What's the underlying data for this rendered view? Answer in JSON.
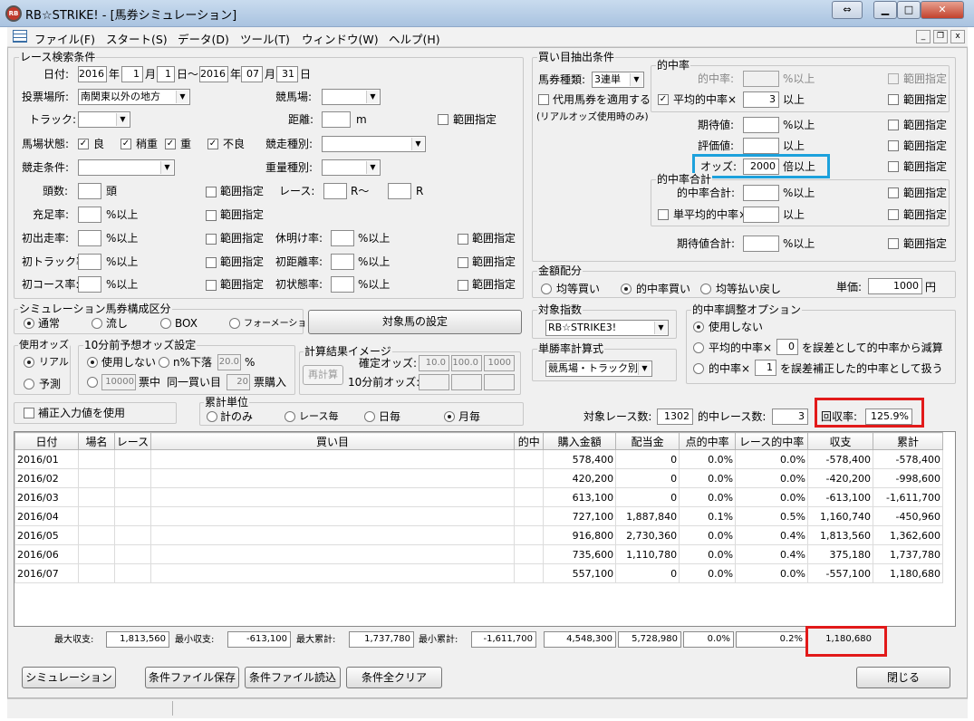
{
  "window": {
    "title": "RB☆STRIKE! - [馬券シミュレーション]",
    "icon_text": "RB"
  },
  "menu": [
    "ファイル(F)",
    "スタート(S)",
    "データ(D)",
    "ツール(T)",
    "ウィンドウ(W)",
    "ヘルプ(H)"
  ],
  "search": {
    "title": "レース検索条件",
    "date_label": "日付:",
    "date_from": {
      "year": "2016",
      "month": "1",
      "day": "1"
    },
    "date_to": {
      "year": "2016",
      "month": "07",
      "day": "31"
    },
    "year_label": "年",
    "month_label": "月",
    "day_label": "日",
    "range_sep": "日〜",
    "vote_place_label": "投票場所:",
    "vote_place": "南関東以外の地方",
    "racecourse_label": "競馬場:",
    "racecourse": "",
    "track_label": "トラック:",
    "track": "",
    "distance_label": "距離:",
    "distance": "",
    "distance_unit": "m",
    "range_label": "範囲指定",
    "baba_label": "馬場状態:",
    "baba": [
      {
        "label": "良",
        "checked": true
      },
      {
        "label": "稍重",
        "checked": true
      },
      {
        "label": "重",
        "checked": true
      },
      {
        "label": "不良",
        "checked": true
      }
    ],
    "race_kind_label": "競走種別:",
    "race_kind": "",
    "race_cond_label": "競走条件:",
    "race_cond": "",
    "weight_label": "重量種別:",
    "weight": "",
    "heads_label": "頭数:",
    "heads_unit": "頭",
    "race_label": "レース:",
    "race_r": "R〜",
    "race_r2": "R",
    "juuten_label": "充足率:",
    "pct_ijou": "%以上",
    "first_label": "初出走率:",
    "kyumei_label": "休明け率:",
    "first_track_label": "初トラック率:",
    "first_dist_label": "初距離率:",
    "first_course_label": "初コース率:",
    "first_jotai_label": "初状態率:"
  },
  "sim": {
    "title": "シミュレーション馬券構成区分",
    "options": [
      "通常",
      "流し",
      "BOX",
      "フォーメーション"
    ],
    "selected": 0,
    "target_btn": "対象馬の設定"
  },
  "odds_use": {
    "title": "使用オッズ",
    "options": [
      "リアル",
      "予測"
    ],
    "selected": 0
  },
  "pre10": {
    "title": "10分前予想オッズ設定",
    "opt1": "使用しない",
    "opt2": "n%下落",
    "pct": "20.0",
    "pct_unit": "%",
    "count": "10000",
    "count_unit": "票中",
    "same_label": "同一買い目",
    "same": "20",
    "same_unit": "票購入"
  },
  "calc_image": {
    "title": "計算結果イメージ",
    "recalc": "再計算",
    "kakutei_label": "確定オッズ:",
    "kakutei": [
      "10.0",
      "100.0",
      "1000"
    ],
    "pre10_label": "10分前オッズ:"
  },
  "hosei": {
    "label": "補正入力値を使用",
    "checked": false
  },
  "ruikei": {
    "title": "累計単位",
    "options": [
      "計のみ",
      "レース毎",
      "日毎",
      "月毎"
    ],
    "selected": 3
  },
  "kaime": {
    "title": "買い目抽出条件",
    "baken_label": "馬券種類:",
    "baken": "3連単",
    "daiyo_label": "代用馬券を適用する",
    "daiyo_note": "(リアルオッズ使用時のみ)",
    "tekichu_title": "的中率",
    "tekichu_label": "的中率:",
    "avg_label": "平均的中率×",
    "avg_value": "3",
    "avg_checked": true,
    "ijou": "以上",
    "pct_ijou": "%以上",
    "kitai_label": "期待値:",
    "hyoka_label": "評価値:",
    "odds_label": "オッズ:",
    "odds_value": "2000",
    "odds_unit": "倍以上",
    "goukei_title": "的中率合計",
    "goukei_label": "的中率合計:",
    "tan_avg_label": "単平均的中率×",
    "kitai_goukei_label": "期待値合計:",
    "range_label": "範囲指定"
  },
  "kingaku": {
    "title": "金額配分",
    "options": [
      "均等買い",
      "的中率買い",
      "均等払い戻し"
    ],
    "selected": 1,
    "tanka_label": "単価:",
    "tanka": "1000",
    "tanka_unit": "円"
  },
  "shisu": {
    "title": "対象指数",
    "value": "RB☆STRIKE3!"
  },
  "tansho": {
    "title": "単勝率計算式",
    "value": "競馬場・トラック別"
  },
  "option": {
    "title": "的中率調整オプション",
    "opt0": "使用しない",
    "opt1_pre": "平均的中率×",
    "opt1_val": "0",
    "opt1_post": "を誤差として的中率から減算",
    "opt2_pre": "的中率×",
    "opt2_val": "1",
    "opt2_post": "を誤差補正した的中率として扱う",
    "selected": 0
  },
  "summary": {
    "races_label": "対象レース数:",
    "races": "1302",
    "hit_label": "的中レース数:",
    "hit": "3",
    "kaishu_label": "回収率:",
    "kaishu": "125.9%"
  },
  "table": {
    "headers": [
      "日付",
      "場名",
      "レース",
      "買い目",
      "的中",
      "購入金額",
      "配当金",
      "点的中率",
      "レース的中率",
      "収支",
      "累計"
    ],
    "rows": [
      [
        "2016/01",
        "",
        "",
        "",
        "",
        "578,400",
        "0",
        "0.0%",
        "0.0%",
        "-578,400",
        "-578,400"
      ],
      [
        "2016/02",
        "",
        "",
        "",
        "",
        "420,200",
        "0",
        "0.0%",
        "0.0%",
        "-420,200",
        "-998,600"
      ],
      [
        "2016/03",
        "",
        "",
        "",
        "",
        "613,100",
        "0",
        "0.0%",
        "0.0%",
        "-613,100",
        "-1,611,700"
      ],
      [
        "2016/04",
        "",
        "",
        "",
        "",
        "727,100",
        "1,887,840",
        "0.1%",
        "0.5%",
        "1,160,740",
        "-450,960"
      ],
      [
        "2016/05",
        "",
        "",
        "",
        "",
        "916,800",
        "2,730,360",
        "0.0%",
        "0.4%",
        "1,813,560",
        "1,362,600"
      ],
      [
        "2016/06",
        "",
        "",
        "",
        "",
        "735,600",
        "1,110,780",
        "0.0%",
        "0.4%",
        "375,180",
        "1,737,780"
      ],
      [
        "2016/07",
        "",
        "",
        "",
        "",
        "557,100",
        "0",
        "0.0%",
        "0.0%",
        "-557,100",
        "1,180,680"
      ]
    ]
  },
  "footer": {
    "max_shushi_label": "最大収支:",
    "max_shushi": "1,813,560",
    "min_shushi_label": "最小収支:",
    "min_shushi": "-613,100",
    "max_ruikei_label": "最大累計:",
    "max_ruikei": "1,737,780",
    "min_ruikei_label": "最小累計:",
    "min_ruikei": "-1,611,700",
    "kounyu": "4,548,300",
    "haito": "5,728,980",
    "ten": "0.0%",
    "race": "0.2%",
    "ruikei": "1,180,680"
  },
  "buttons": {
    "simulate": "シミュレーション",
    "save": "条件ファイル保存",
    "load": "条件ファイル読込",
    "clear": "条件全クリア",
    "close": "閉じる"
  }
}
